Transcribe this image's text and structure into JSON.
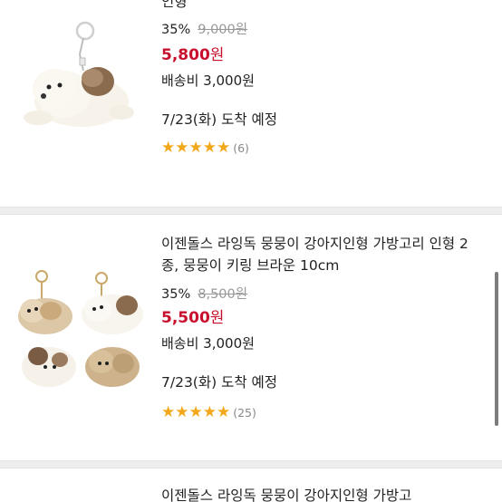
{
  "products": [
    {
      "title_partial": "인형",
      "discount": "35%",
      "original_price": "9,000원",
      "price_value": "5,800",
      "price_unit": "원",
      "shipping": "배송비 3,000원",
      "arrival": "7/23(화) 도착 예정",
      "stars": "★★★★★",
      "review_count": "(6)"
    },
    {
      "title": "이젠돌스 라잉독 뭉뭉이 강아지인형 가방고리 인형 2종, 뭉뭉이 키링 브라운 10cm",
      "discount": "35%",
      "original_price": "8,500원",
      "price_value": "5,500",
      "price_unit": "원",
      "shipping": "배송비 3,000원",
      "arrival": "7/23(화) 도착 예정",
      "stars": "★★★★★",
      "review_count": "(25)"
    },
    {
      "title_partial": "이젠돌스 라잉독 뭉뭉이 강아지인형 가방고"
    }
  ],
  "icons": {
    "star": "star-icon",
    "product_image": "plush-dog-keyring-image"
  },
  "colors": {
    "price_red": "#c8102e",
    "star_gold": "#f3a81b",
    "divider_gray": "#eeeeee"
  }
}
